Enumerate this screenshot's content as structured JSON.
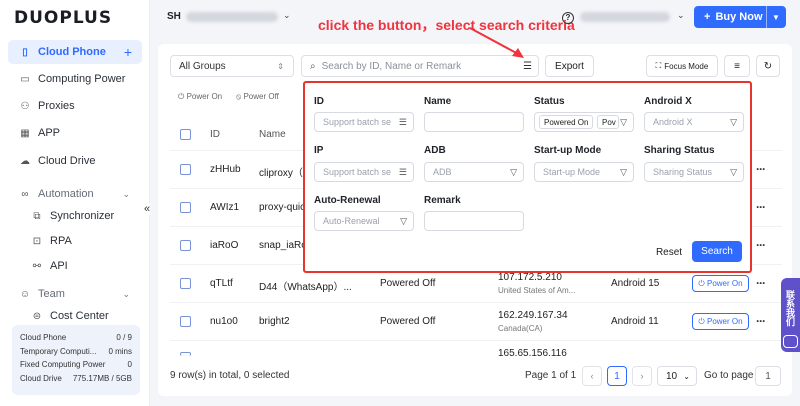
{
  "brand": "DUOPLUS",
  "topbar": {
    "account_prefix": "SH",
    "hint": "click the button，select search criteria",
    "buy_label": "Buy Now"
  },
  "sidebar": {
    "items": [
      {
        "label": "Cloud Phone",
        "icon": "phone-icon"
      },
      {
        "label": "Computing Power",
        "icon": "monitor-icon"
      },
      {
        "label": "Proxies",
        "icon": "network-icon"
      },
      {
        "label": "APP",
        "icon": "grid-icon"
      },
      {
        "label": "Cloud Drive",
        "icon": "cloud-icon"
      },
      {
        "label": "Automation",
        "icon": "infinity-icon"
      },
      {
        "label": "Synchronizer",
        "icon": "sync-icon"
      },
      {
        "label": "RPA",
        "icon": "robot-icon"
      },
      {
        "label": "API",
        "icon": "api-icon"
      },
      {
        "label": "Team",
        "icon": "team-icon"
      },
      {
        "label": "Cost Center",
        "icon": "cost-icon"
      }
    ],
    "stats": [
      {
        "label": "Cloud Phone",
        "value": "0 / 9"
      },
      {
        "label": "Temporary Computi...",
        "value": "0 mins"
      },
      {
        "label": "Fixed Computing Power",
        "value": "0"
      },
      {
        "label": "Cloud Drive",
        "value": "775.17MB / 5GB"
      }
    ]
  },
  "toolbar": {
    "group_select": "All Groups",
    "search_placeholder": "Search by ID, Name or Remark",
    "export_label": "Export",
    "focus_label": "Focus Mode",
    "power_on": "Power On",
    "power_off": "Power Off"
  },
  "table": {
    "headers": {
      "id": "ID",
      "name": "Name"
    },
    "rows": [
      {
        "id": "zHHub",
        "name": "cliproxy（T"
      },
      {
        "id": "AWIz1",
        "name": "proxy-quic"
      },
      {
        "id": "iaRoO",
        "name": "snap_iaRo"
      },
      {
        "id": "qTLtf",
        "name": "D44（WhatsApp）...",
        "status": "Powered Off",
        "ip": "107.172.5.210",
        "location": "United States of Am...",
        "android": "Android 15",
        "action": "Power On"
      },
      {
        "id": "nu1o0",
        "name": "bright2",
        "status": "Powered Off",
        "ip": "162.249.167.34",
        "location": "Canada(CA)",
        "android": "Android 11",
        "action": "Power On"
      },
      {
        "ip": "165.65.156.116"
      }
    ]
  },
  "filter": {
    "fields": [
      {
        "label": "ID",
        "placeholder": "Support batch se"
      },
      {
        "label": "Name",
        "placeholder": ""
      },
      {
        "label": "Status",
        "tag": "Powered On",
        "tag2": "Pov"
      },
      {
        "label": "Android X",
        "placeholder": "Android X"
      },
      {
        "label": "IP",
        "placeholder": "Support batch se"
      },
      {
        "label": "ADB",
        "placeholder": "ADB"
      },
      {
        "label": "Start-up Mode",
        "placeholder": "Start-up Mode"
      },
      {
        "label": "Sharing Status",
        "placeholder": "Sharing Status"
      },
      {
        "label": "Auto-Renewal",
        "placeholder": "Auto-Renewal"
      },
      {
        "label": "Remark",
        "placeholder": ""
      }
    ],
    "reset_label": "Reset",
    "search_label": "Search"
  },
  "footer": {
    "summary": "9 row(s) in total, 0 selected",
    "page_info": "Page 1 of 1",
    "current_page": "1",
    "page_size": "10",
    "goto_label": "Go to page",
    "goto_value": "1"
  },
  "float": {
    "contact": "联系我们"
  },
  "colors": {
    "accent": "#2f6bff",
    "highlight": "#e8342e"
  }
}
